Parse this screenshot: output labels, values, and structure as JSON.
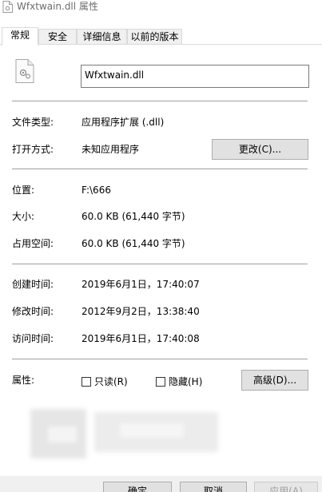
{
  "window": {
    "title": "Wfxtwain.dll 属性"
  },
  "tabs": [
    {
      "label": "常规",
      "active": true
    },
    {
      "label": "安全",
      "active": false
    },
    {
      "label": "详细信息",
      "active": false
    },
    {
      "label": "以前的版本",
      "active": false
    }
  ],
  "file": {
    "name": "Wfxtwain.dll"
  },
  "info": {
    "type_label": "文件类型:",
    "type_value": "应用程序扩展 (.dll)",
    "open_label": "打开方式:",
    "open_value": "未知应用程序",
    "change_button": "更改(C)...",
    "location_label": "位置:",
    "location_value": "F:\\666",
    "size_label": "大小:",
    "size_value": "60.0 KB (61,440 字节)",
    "disk_label": "占用空间:",
    "disk_value": "60.0 KB (61,440 字节)",
    "created_label": "创建时间:",
    "created_value": "2019年6月1日，17:40:07",
    "modified_label": "修改时间:",
    "modified_value": "2012年9月2日，13:38:40",
    "accessed_label": "访问时间:",
    "accessed_value": "2019年6月1日，17:40:08",
    "attributes_label": "属性:",
    "readonly_label": "只读(R)",
    "hidden_label": "隐藏(H)",
    "advanced_button": "高级(D)..."
  },
  "footer": {
    "ok": "确定",
    "cancel": "取消",
    "apply": "应用(A)"
  }
}
